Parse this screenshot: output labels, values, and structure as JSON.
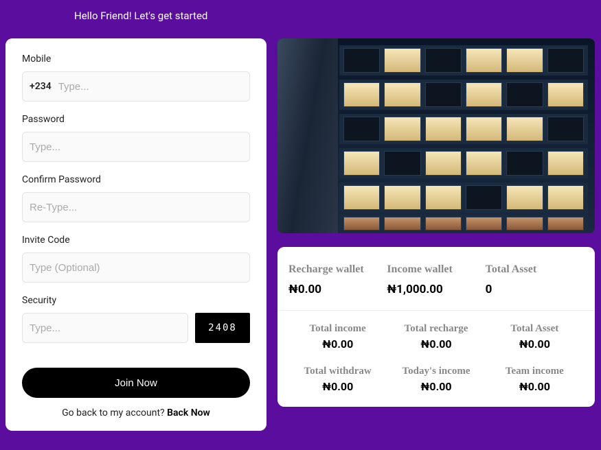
{
  "greeting": "Hello Friend! Let's get started",
  "form": {
    "mobile": {
      "label": "Mobile",
      "prefix": "+234",
      "placeholder": "Type..."
    },
    "password": {
      "label": "Password",
      "placeholder": "Type..."
    },
    "confirm": {
      "label": "Confirm Password",
      "placeholder": "Re-Type..."
    },
    "invite": {
      "label": "Invite Code",
      "placeholder": "Type (Optional)"
    },
    "security": {
      "label": "Security",
      "placeholder": "Type...",
      "captcha": "2408"
    },
    "submit_label": "Join Now",
    "back_prompt": "Go back to my account? ",
    "back_link": "Back Now"
  },
  "wallets": {
    "top": [
      {
        "label": "Recharge wallet",
        "value": "₦0.00"
      },
      {
        "label": "Income wallet",
        "value": "₦1,000.00"
      },
      {
        "label": "Total Asset",
        "value": "0"
      }
    ],
    "stats": [
      {
        "label": "Total income",
        "value": "₦0.00"
      },
      {
        "label": "Total recharge",
        "value": "₦0.00"
      },
      {
        "label": "Total Asset",
        "value": "₦0.00"
      },
      {
        "label": "Total withdraw",
        "value": "₦0.00"
      },
      {
        "label": "Today's income",
        "value": "₦0.00"
      },
      {
        "label": "Team income",
        "value": "₦0.00"
      }
    ]
  }
}
